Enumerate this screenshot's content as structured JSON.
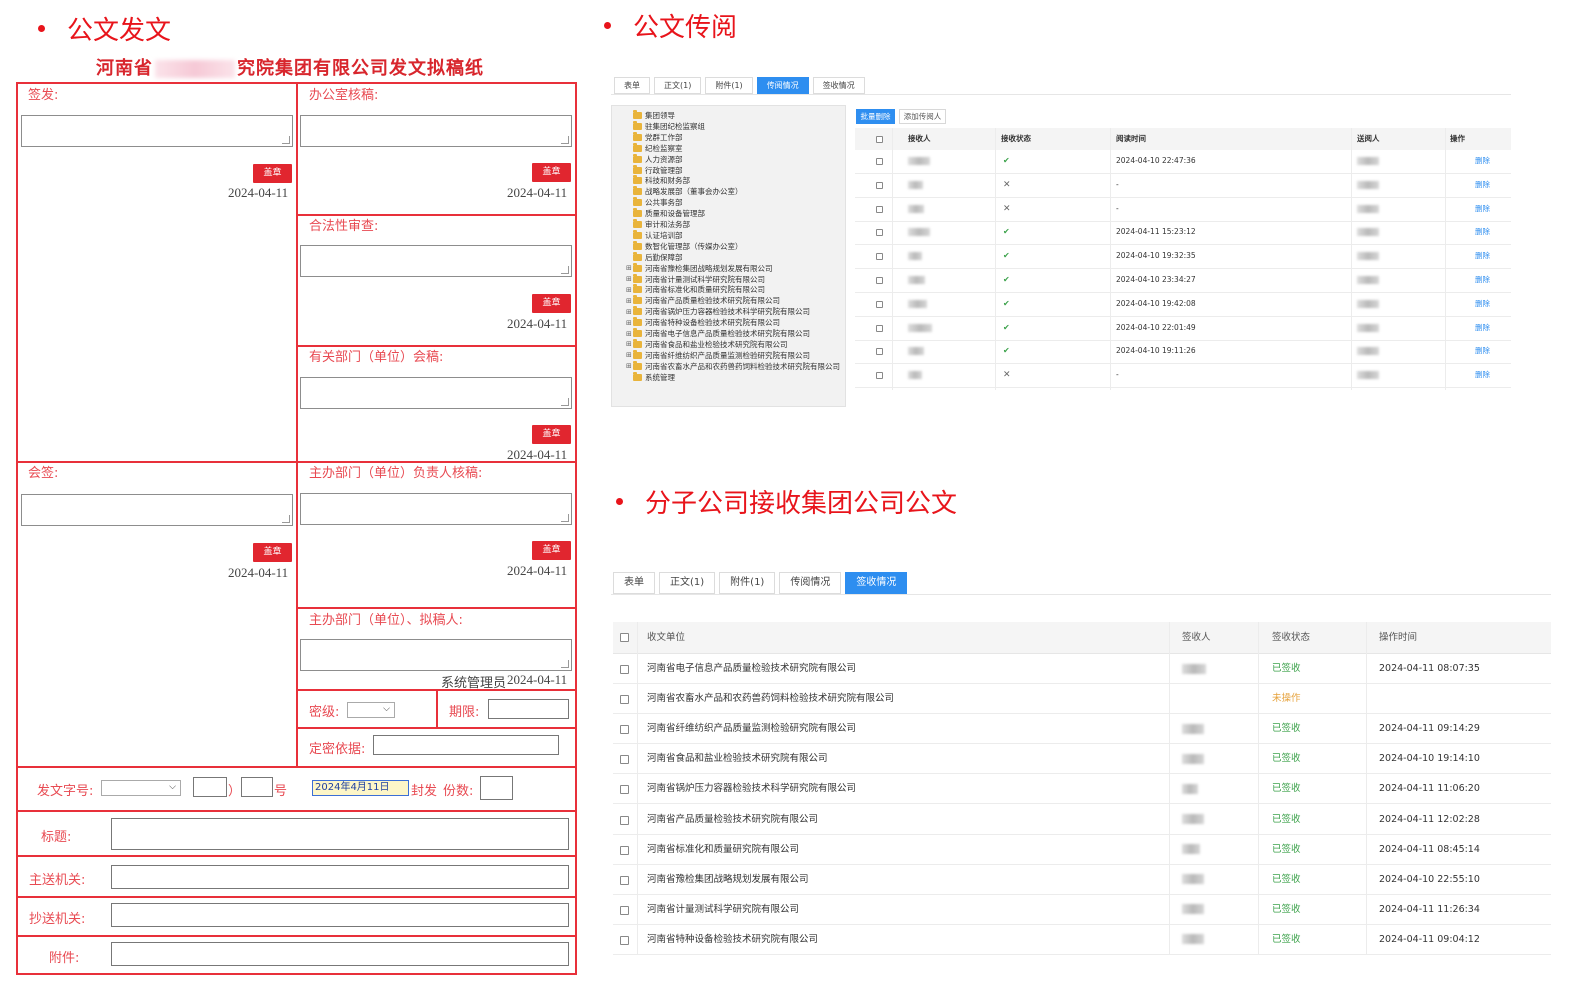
{
  "sections": {
    "dispatch": "公文发文",
    "circulation": "公文传阅",
    "receive": "分子公司接收集团公司公文"
  },
  "form": {
    "title_left": "河南省",
    "title_right": "究院集团有限公司发文拟稿纸",
    "labels": {
      "sign": "签发:",
      "office_review": "办公室核稿:",
      "legal_review": "合法性审查:",
      "dept_cosign": "有关部门（单位）会稿:",
      "countersign": "会签:",
      "host_head_review": "主办部门（单位）负责人核稿:",
      "host_drafter": "主办部门（单位）、拟稿人:",
      "secret_level": "密级:",
      "deadline": "期限:",
      "secret_basis": "定密依据:",
      "doc_number": "发文字号:",
      "paren_open": "（",
      "paren_close": "）",
      "number_suffix": "号",
      "seal_word": "封发",
      "copies": "份数:",
      "subject": "标题:",
      "main_to": "主送机关:",
      "cc_to": "抄送机关:",
      "attachment": "附件:"
    },
    "stamp_label": "盖章",
    "date": "2024-04-11",
    "drafter_name": "系统管理员",
    "seal_date": "2024年4月11日"
  },
  "circulation": {
    "tabs": [
      "表单",
      "正文(1)",
      "附件(1)",
      "传阅情况",
      "签收情况"
    ],
    "active_tab": "传阅情况",
    "tree": [
      {
        "label": "集团领导",
        "expandable": false
      },
      {
        "label": "驻集团纪检监察组",
        "expandable": false
      },
      {
        "label": "党群工作部",
        "expandable": false
      },
      {
        "label": "纪检监察室",
        "expandable": false
      },
      {
        "label": "人力资源部",
        "expandable": false
      },
      {
        "label": "行政管理部",
        "expandable": false
      },
      {
        "label": "科技和财务部",
        "expandable": false
      },
      {
        "label": "战略发展部（董事会办公室）",
        "expandable": false
      },
      {
        "label": "公共事务部",
        "expandable": false
      },
      {
        "label": "质量和设备管理部",
        "expandable": false
      },
      {
        "label": "审计和法务部",
        "expandable": false
      },
      {
        "label": "认证培训部",
        "expandable": false
      },
      {
        "label": "数智化管理部（传媒办公室）",
        "expandable": false
      },
      {
        "label": "后勤保障部",
        "expandable": false
      },
      {
        "label": "河南省豫检集团战略规划发展有限公司",
        "expandable": true
      },
      {
        "label": "河南省计量测试科学研究院有限公司",
        "expandable": true
      },
      {
        "label": "河南省标准化和质量研究院有限公司",
        "expandable": true
      },
      {
        "label": "河南省产品质量检验技术研究院有限公司",
        "expandable": true
      },
      {
        "label": "河南省锅炉压力容器检验技术科学研究院有限公司",
        "expandable": true
      },
      {
        "label": "河南省特种设备检验技术研究院有限公司",
        "expandable": true
      },
      {
        "label": "河南省电子信息产品质量检验技术研究院有限公司",
        "expandable": true
      },
      {
        "label": "河南省食品和盐业检验技术研究院有限公司",
        "expandable": true
      },
      {
        "label": "河南省纤维纺织产品质量监测检验研究院有限公司",
        "expandable": true
      },
      {
        "label": "河南省农畜水产品和农药兽药饲料检验技术研究院有限公司",
        "expandable": true
      },
      {
        "label": "系统管理",
        "expandable": false
      }
    ],
    "buttons": {
      "batch_delete": "批量删除",
      "add_reader": "添加传阅人"
    },
    "columns": [
      "接收人",
      "接收状态",
      "阅读时间",
      "送阅人",
      "操作"
    ],
    "rows": [
      {
        "status": "read",
        "time": "2024-04-10 22:47:36"
      },
      {
        "status": "unread",
        "time": "-"
      },
      {
        "status": "unread",
        "time": "-"
      },
      {
        "status": "read",
        "time": "2024-04-11 15:23:12"
      },
      {
        "status": "read",
        "time": "2024-04-10 19:32:35"
      },
      {
        "status": "read",
        "time": "2024-04-10 23:34:27"
      },
      {
        "status": "read",
        "time": "2024-04-10 19:42:08"
      },
      {
        "status": "read",
        "time": "2024-04-10 22:01:49"
      },
      {
        "status": "read",
        "time": "2024-04-10 19:11:26"
      },
      {
        "status": "unread",
        "time": "-"
      }
    ],
    "action_label": "删除"
  },
  "receive": {
    "tabs": [
      "表单",
      "正文(1)",
      "附件(1)",
      "传阅情况",
      "签收情况"
    ],
    "active_tab": "签收情况",
    "columns": [
      "收文单位",
      "签收人",
      "签收状态",
      "操作时间"
    ],
    "rows": [
      {
        "unit": "河南省电子信息产品质量检验技术研究院有限公司",
        "status": "已签收",
        "signed": true,
        "time": "2024-04-11 08:07:35"
      },
      {
        "unit": "河南省农畜水产品和农药兽药饲料检验技术研究院有限公司",
        "status": "未操作",
        "signed": false,
        "time": ""
      },
      {
        "unit": "河南省纤维纺织产品质量监测检验研究院有限公司",
        "status": "已签收",
        "signed": true,
        "time": "2024-04-11 09:14:29"
      },
      {
        "unit": "河南省食品和盐业检验技术研究院有限公司",
        "status": "已签收",
        "signed": true,
        "time": "2024-04-10 19:14:10"
      },
      {
        "unit": "河南省锅炉压力容器检验技术科学研究院有限公司",
        "status": "已签收",
        "signed": true,
        "time": "2024-04-11 11:06:20"
      },
      {
        "unit": "河南省产品质量检验技术研究院有限公司",
        "status": "已签收",
        "signed": true,
        "time": "2024-04-11 12:02:28"
      },
      {
        "unit": "河南省标准化和质量研究院有限公司",
        "status": "已签收",
        "signed": true,
        "time": "2024-04-11 08:45:14"
      },
      {
        "unit": "河南省豫检集团战略规划发展有限公司",
        "status": "已签收",
        "signed": true,
        "time": "2024-04-10 22:55:10"
      },
      {
        "unit": "河南省计量测试科学研究院有限公司",
        "status": "已签收",
        "signed": true,
        "time": "2024-04-11 11:26:34"
      },
      {
        "unit": "河南省特种设备检验技术研究院有限公司",
        "status": "已签收",
        "signed": true,
        "time": "2024-04-11 09:04:12"
      }
    ]
  },
  "colors": {
    "accent_red": "#e8141b",
    "form_line": "#e8303a",
    "primary_blue": "#2e8ef0",
    "status_green": "#3ca24b",
    "status_orange": "#e6a23c"
  }
}
